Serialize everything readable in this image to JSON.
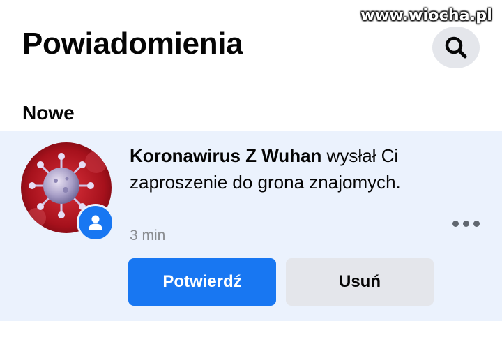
{
  "watermark": "www.wiocha.pl",
  "header": {
    "title": "Powiadomienia",
    "search_icon": "search-icon"
  },
  "section": {
    "title": "Nowe"
  },
  "notification": {
    "sender": "Koronawirus Z Wuhan",
    "message": " wysłał Ci zaproszenie do grona znajomych.",
    "time": "3 min",
    "badge_icon": "person-icon",
    "more_icon": "more-horizontal-icon",
    "actions": {
      "confirm_label": "Potwierdź",
      "delete_label": "Usuń"
    }
  },
  "colors": {
    "accent": "#1877f2",
    "highlight_bg": "#ebf2fd",
    "secondary_button": "#e4e6eb",
    "muted_text": "#8a8d91"
  }
}
